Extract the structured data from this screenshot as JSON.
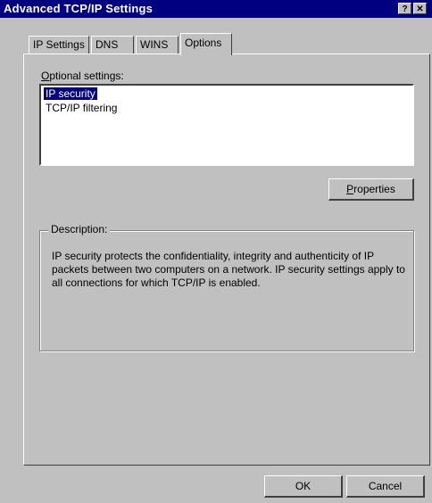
{
  "window": {
    "title": "Advanced TCP/IP Settings",
    "help_glyph": "?",
    "close_glyph": "✕"
  },
  "tabs": [
    {
      "label": "IP Settings",
      "active": false
    },
    {
      "label": "DNS",
      "active": false
    },
    {
      "label": "WINS",
      "active": false
    },
    {
      "label": "Options",
      "active": true
    }
  ],
  "options": {
    "label_prefix": "O",
    "label_rest": "ptional settings:",
    "items": [
      {
        "label": "IP security",
        "selected": true
      },
      {
        "label": "TCP/IP filtering",
        "selected": false
      }
    ],
    "properties_prefix": "P",
    "properties_rest": "roperties"
  },
  "description": {
    "label": "Description:",
    "text": "IP security protects the confidentiality, integrity and authenticity of IP packets between two computers on a network. IP security settings apply to all connections for which TCP/IP is enabled."
  },
  "footer": {
    "ok_label": "OK",
    "cancel_label": "Cancel"
  },
  "colors": {
    "titlebar": "#000080",
    "face": "#c0c0c0",
    "selection": "#000080"
  }
}
